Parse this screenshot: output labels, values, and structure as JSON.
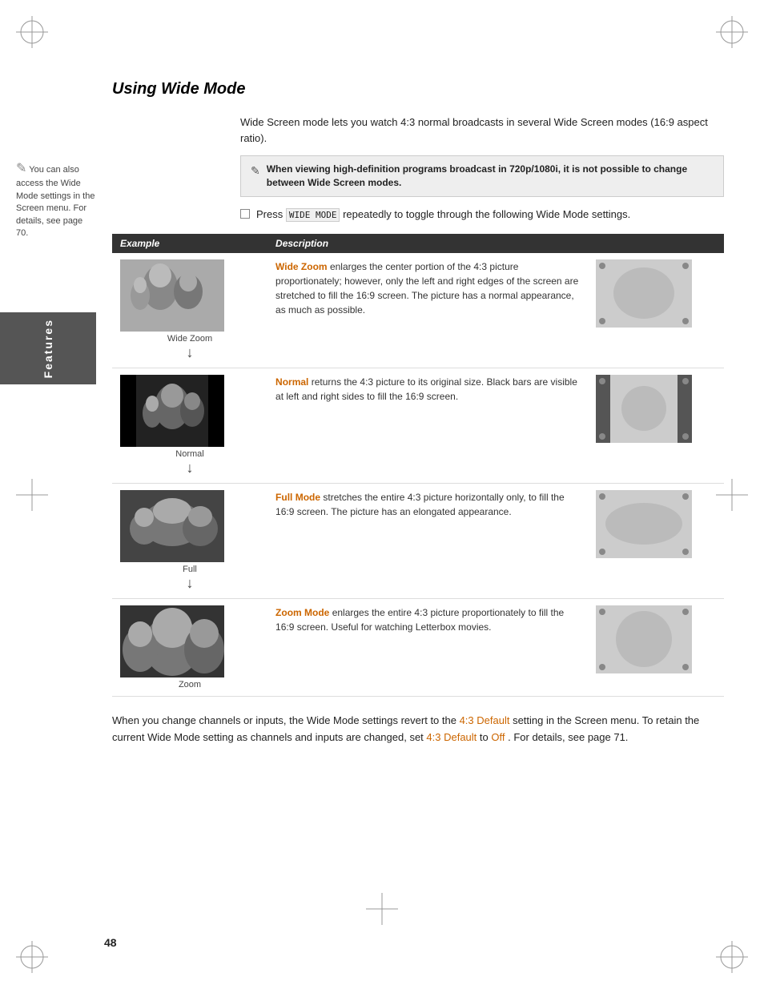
{
  "page": {
    "title": "Using Wide Mode",
    "number": "48",
    "sidebar_label": "Features"
  },
  "sidebar_note": {
    "text": "You can also access the Wide Mode settings in the Screen menu. For details, see page 70."
  },
  "main_description": "Wide Screen mode lets you watch 4:3 normal broadcasts in several Wide Screen modes (16:9 aspect ratio).",
  "warning": {
    "icon": "✎",
    "text": "When viewing high-definition programs broadcast in 720p/1080i, it is not possible to change between Wide Screen modes."
  },
  "press_instruction": {
    "prefix": "Press",
    "button": "WIDE MODE",
    "suffix": "repeatedly to toggle through the following Wide Mode settings."
  },
  "table": {
    "headers": [
      "Example",
      "Description"
    ],
    "rows": [
      {
        "mode_name": "Wide Zoom",
        "description": "Wide Zoom enlarges the center portion of the 4:3 picture proportionately; however, only the left and right edges of the screen are stretched to fill the 16:9 screen. The picture has a normal appearance, as much as possible."
      },
      {
        "mode_name": "Normal",
        "description": "Normal returns the 4:3 picture to its original size. Black bars are visible at left and right sides to fill the 16:9 screen."
      },
      {
        "mode_name": "Full Mode",
        "description": "Full Mode stretches the entire 4:3 picture horizontally only, to fill the 16:9 screen. The picture has an elongated appearance."
      },
      {
        "mode_name": "Zoom Mode",
        "description": "Zoom Mode enlarges the entire 4:3 picture proportionately to fill the 16:9 screen. Useful for watching Letterbox movies."
      }
    ],
    "labels": [
      "Wide Zoom",
      "Normal",
      "Full",
      "Zoom"
    ]
  },
  "bottom_note": "When you change channels or inputs, the Wide Mode settings revert to the 4:3 Default setting in the Screen menu. To retain the current Wide Mode setting as channels and inputs are changed, set 4:3 Default to Off. For details, see page 71.",
  "highlight_terms": [
    "4:3 Default",
    "4:3 Default",
    "Off"
  ]
}
